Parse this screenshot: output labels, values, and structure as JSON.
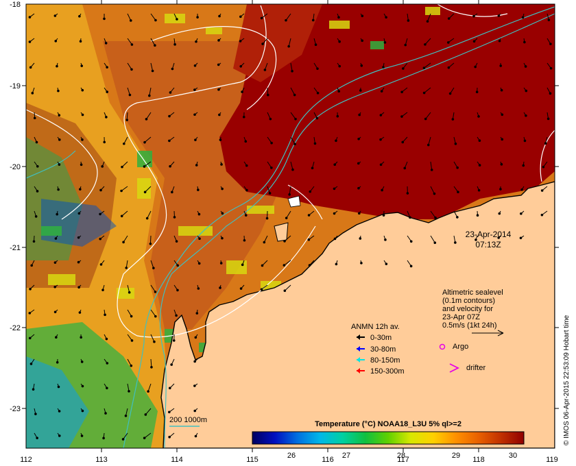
{
  "map": {
    "x_ticks": [
      "112",
      "113",
      "114",
      "115",
      "116",
      "117",
      "118",
      "119"
    ],
    "y_ticks": [
      "-18",
      "-19",
      "-20",
      "-21",
      "-22",
      "-23"
    ],
    "date_line1": "23-Apr-2014",
    "date_line2": "07:13Z",
    "credit": "© IMOS 06-Apr-2015 22:53:09 Hobart time"
  },
  "altimetry": {
    "lines": [
      "Altimetric sealevel",
      "(0.1m contours)",
      "and velocity for",
      "23-Apr 07Z",
      "0.5m/s (1kt 24h)"
    ]
  },
  "anmn_legend": {
    "title": "ANMN 12h av.",
    "items": [
      {
        "label": "0-30m",
        "color": "#000000"
      },
      {
        "label": "30-80m",
        "color": "#0000ff"
      },
      {
        "label": "80-150m",
        "color": "#00e5e5"
      },
      {
        "label": "150-300m",
        "color": "#ff0000"
      }
    ]
  },
  "markers": {
    "argo": "Argo",
    "drifter": "drifter",
    "argo_color": "#e600e6",
    "drifter_color": "#e600e6"
  },
  "bathy": {
    "label": "200  1000m",
    "color": "#40c0c0"
  },
  "colorbar": {
    "title": "Temperature (°C) NOAA18_L3U 5% ql>=2",
    "ticks": [
      "26",
      "27",
      "28",
      "29",
      "30"
    ],
    "stops": [
      "#000060",
      "#0010c0",
      "#0070e0",
      "#00b8e8",
      "#00d0a0",
      "#10c040",
      "#60d000",
      "#d8e800",
      "#ffd000",
      "#ff9000",
      "#e86000",
      "#c03000",
      "#900000"
    ]
  },
  "palette": {
    "land": "#ffcc99",
    "sea_hot": "#990000",
    "sea_warm": "#c0540f",
    "sea_mid": "#e89010"
  }
}
